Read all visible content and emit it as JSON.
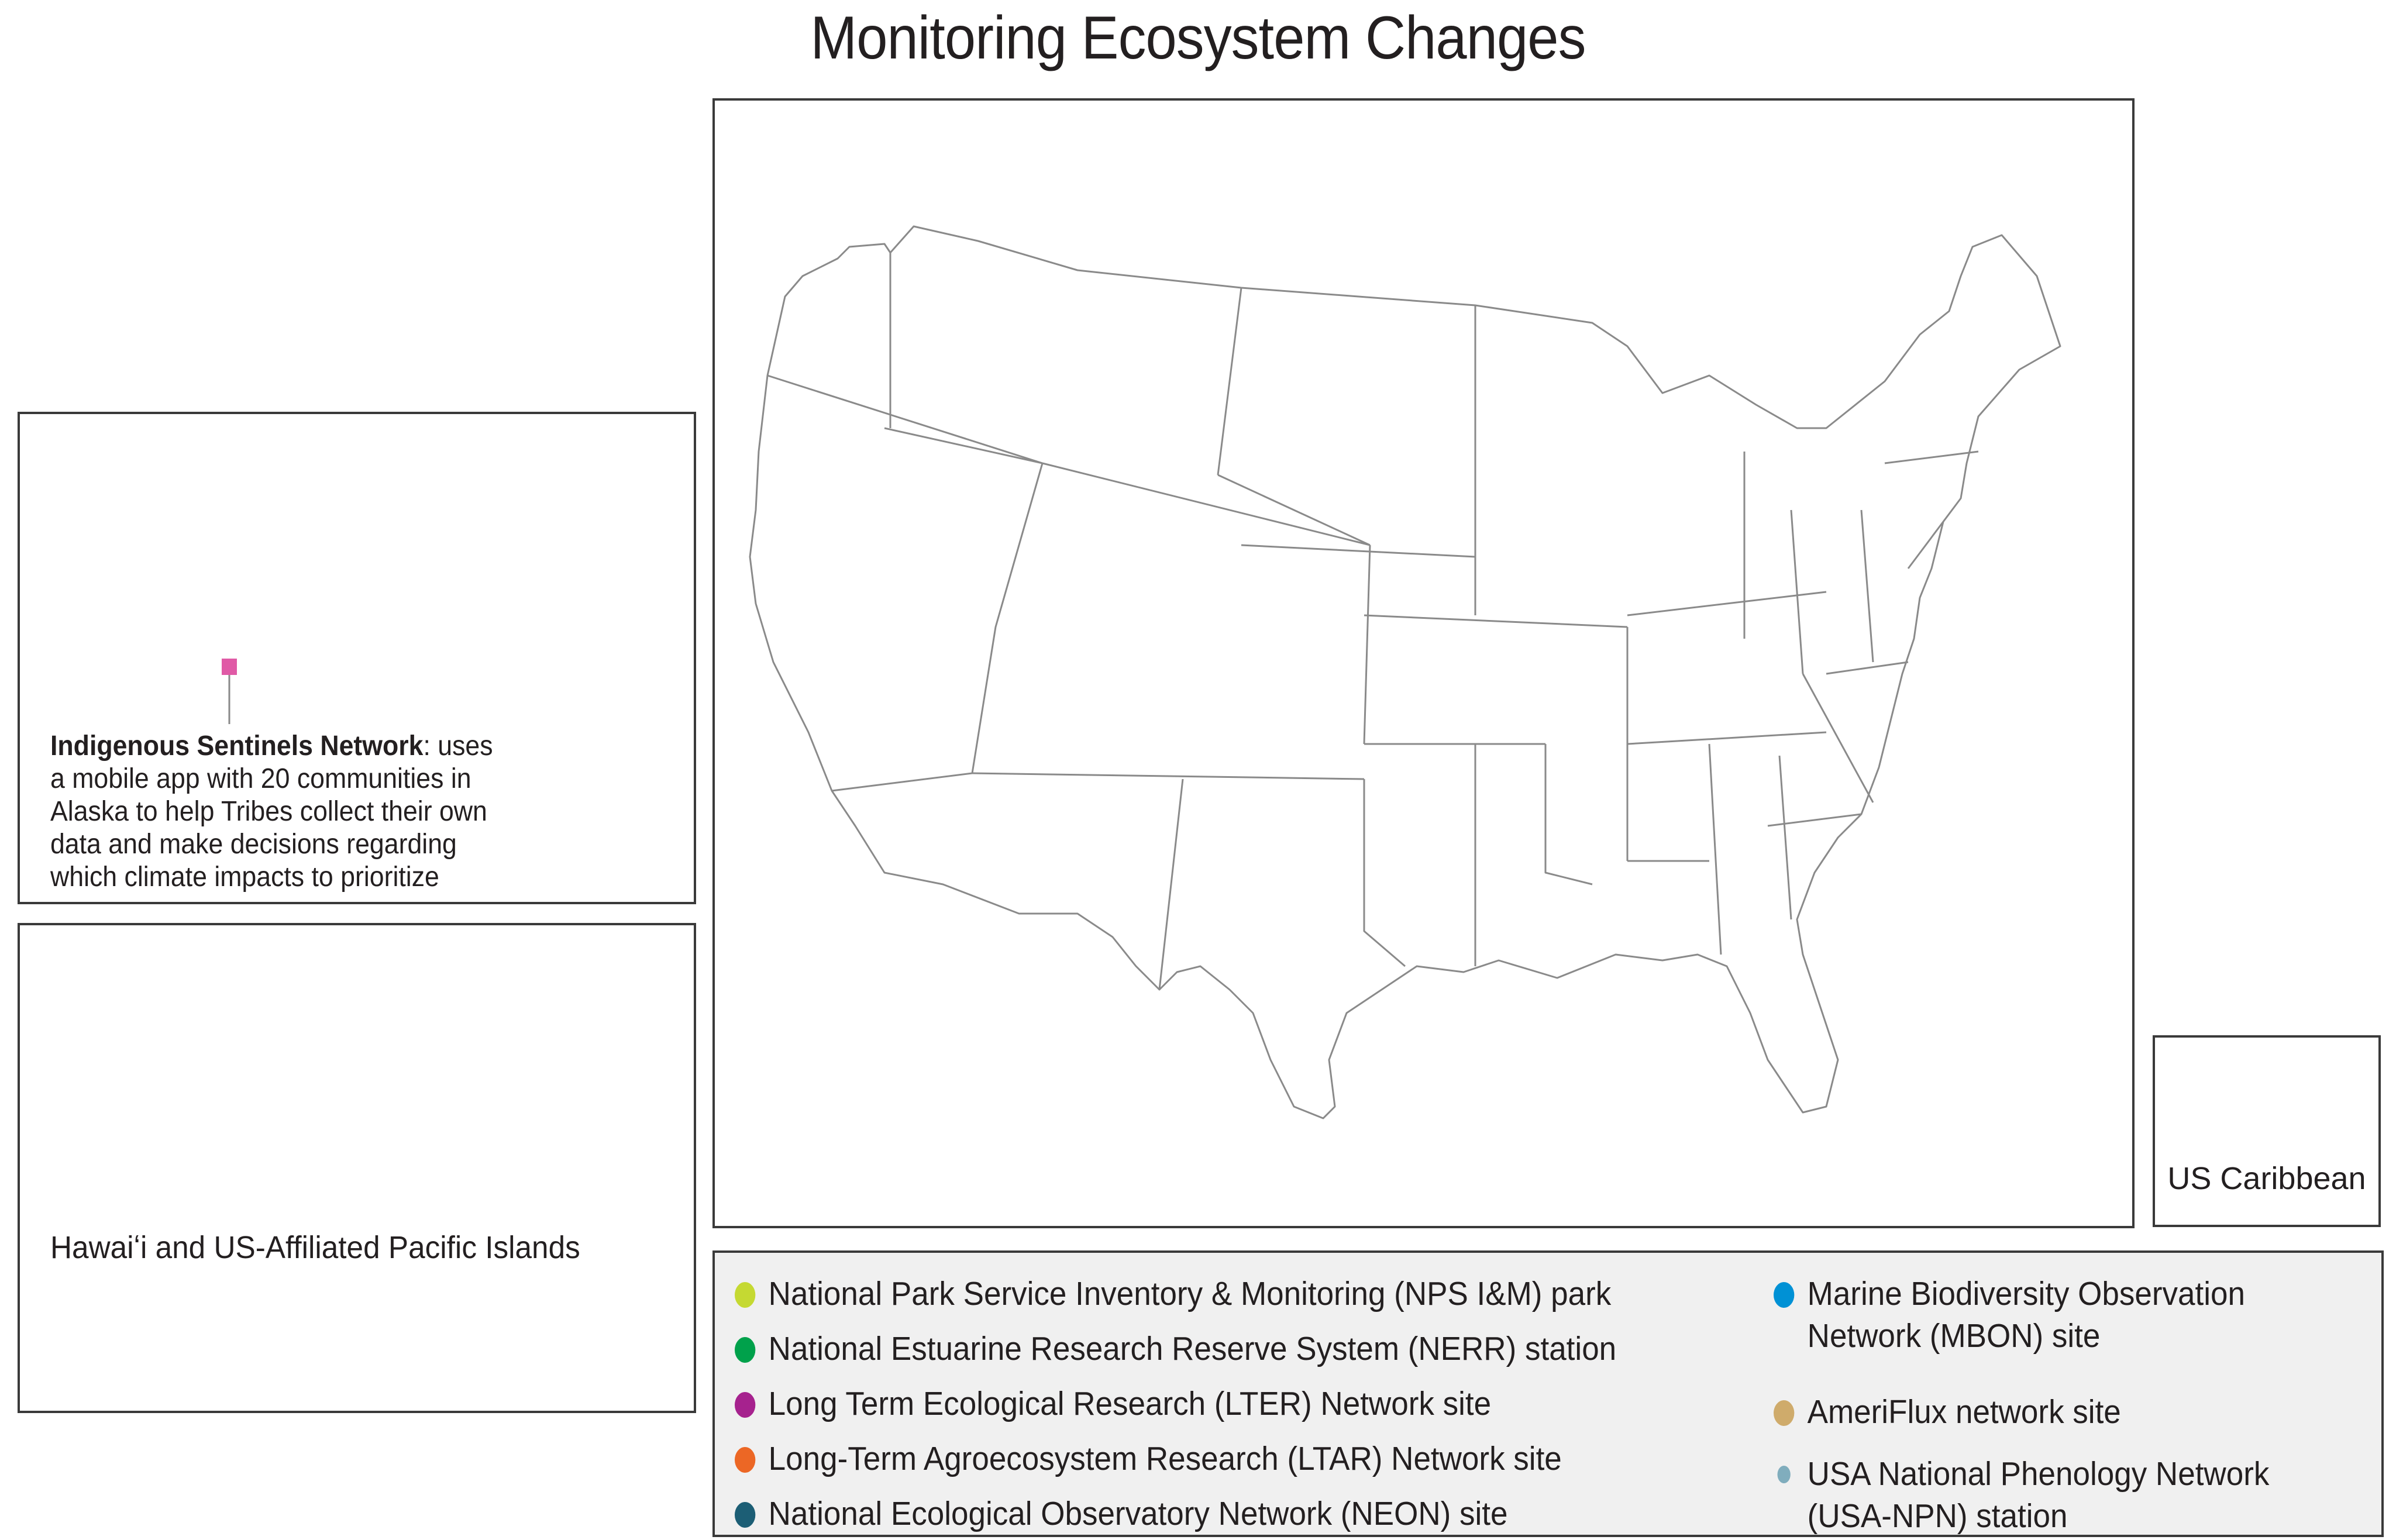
{
  "title": "Monitoring Ecosystem Changes",
  "colors": {
    "nps": "#c5d932",
    "nerr": "#00a14b",
    "lter": "#a6228e",
    "ltar": "#ec6725",
    "neon": "#1c5e75",
    "mbon": "#0091d5",
    "ameriflux": "#cfab6b",
    "npn": "#80adbd",
    "outline": "#8a8a8a",
    "indigenous_marker": "#e05aa6"
  },
  "legend": {
    "items": [
      {
        "key": "nps",
        "label": "National Park Service Inventory & Monitoring (NPS I&M) park"
      },
      {
        "key": "nerr",
        "label": "National Estuarine Research Reserve System (NERR) station"
      },
      {
        "key": "lter",
        "label": "Long Term Ecological Research (LTER) Network site"
      },
      {
        "key": "ltar",
        "label": "Long-Term Agroecosystem Research (LTAR) Network site"
      },
      {
        "key": "neon",
        "label": "National Ecological Observatory Network (NEON) site"
      },
      {
        "key": "mbon",
        "label_line1": "Marine Biodiversity Observation",
        "label_line2": "Network (MBON) site"
      },
      {
        "key": "ameriflux",
        "label": "AmeriFlux network site"
      },
      {
        "key": "npn",
        "label_line1": "USA National Phenology Network",
        "label_line2": "(USA-NPN) station"
      }
    ]
  },
  "alaska": {
    "callout_bold": "Indigenous Sentinels Network",
    "callout_rest_1": ": uses",
    "callout_line2": "a mobile app with 20 communities in",
    "callout_line3": "Alaska to help Tribes collect their own",
    "callout_line4": "data and make decisions regarding",
    "callout_line5": "which climate impacts to prioritize"
  },
  "hawaii": {
    "label": "Hawaiʻi and US-Affiliated Pacific Islands"
  },
  "caribbean": {
    "label": "US Caribbean"
  }
}
